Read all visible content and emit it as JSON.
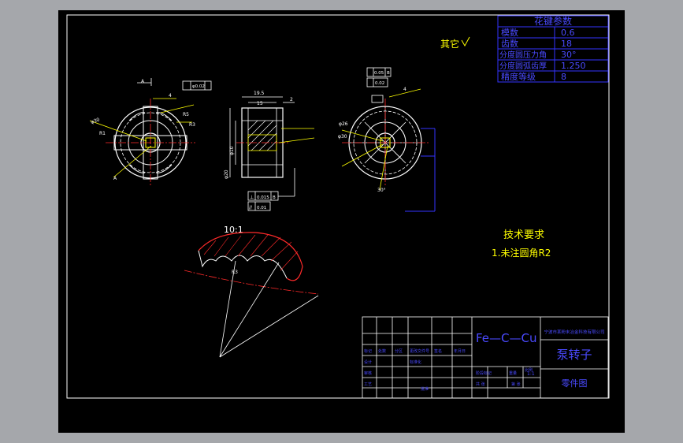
{
  "colors": {
    "frame": "#ffffff",
    "outline": "#ffff00",
    "dimension": "#ffffff",
    "table": "#3333ff",
    "table_text": "#4a4aff",
    "center_line": "#ff2a2a",
    "hatch": "#ff2a2a",
    "note": "#ffff00",
    "material": "#4a4aff"
  },
  "gear_table": {
    "title": "花键参数",
    "rows": [
      {
        "label": "模数",
        "value": "0.6"
      },
      {
        "label": "齿数",
        "value": "18"
      },
      {
        "label": "分度圆压力角",
        "value": "30°"
      },
      {
        "label": "分度圆弧齿厚",
        "value": "1.250"
      },
      {
        "label": "精度等级",
        "value": "8"
      }
    ]
  },
  "roughness_note": "其它",
  "tech_req": {
    "title": "技术要求",
    "item1": "1.未注圆角R2"
  },
  "detail": {
    "scale_label": "10:1",
    "radius_label": "R3"
  },
  "front_view": {
    "section_label": "A",
    "dims": [
      "φ30",
      "R1",
      "4",
      "R5",
      "R3"
    ],
    "tolerance": "φ0.02"
  },
  "side_view": {
    "dims": [
      "19.5",
      "15",
      "2",
      "φ10",
      "φ20"
    ],
    "gdt1": {
      "symbol": "⊥",
      "value": "0.015",
      "datum": "B"
    },
    "gdt2": {
      "symbol": "//",
      "value": "0.01"
    }
  },
  "right_view": {
    "gdt1": {
      "value": "0.05",
      "datum": "B"
    },
    "gdt2": {
      "value": "0.02"
    },
    "dims": [
      "4",
      "φ26",
      "φ30",
      "30°"
    ]
  },
  "title_block": {
    "material": "Fe—C—Cu",
    "part_name": "泵转子",
    "drawing_type": "零件图",
    "company": "宁波市某粉末冶金科技有限公司",
    "scale": "1:1",
    "labels": [
      "标记",
      "处数",
      "分区",
      "更改文件号",
      "签名",
      "年月日",
      "设计",
      "标准化",
      "审核",
      "工艺",
      "批准",
      "阶段标记",
      "重量",
      "比例",
      "共 张",
      "第 张"
    ]
  }
}
